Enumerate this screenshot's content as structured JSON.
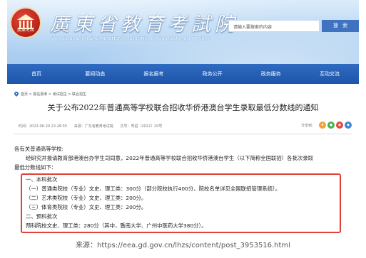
{
  "header": {
    "site_title": "廣東省教育考試院",
    "site_subtitle": "The Education Examinations Authority of Guangdong Province",
    "logo_text": "廣東考試",
    "search_placeholder": "请输入要搜索的内容",
    "search_button": "搜 索"
  },
  "nav": {
    "items": [
      "首页",
      "要闻动态",
      "报名报考",
      "政务公开",
      "政务服务",
      "互动交流"
    ]
  },
  "breadcrumb": {
    "text": "首页 > 报名报考 > 考试招生 > 联合招生"
  },
  "article": {
    "title": "关于公布2022年普通高等学校联合招收华侨港澳台学生录取最低分数线的通知",
    "meta_time": "时间：2022-06-20 22:26:55",
    "meta_source": "来源：广东省教育考试院",
    "meta_doc": "文号：粤招〔2022〕20号",
    "share_label": "分享到：",
    "salutation": "各有关普通高等学校:",
    "para_line1": "经研究并报请教育部港澳台办学生司同意，2022年普通高等学校联合招收华侨港澳台学生（以下简称全国联招）各批次录取",
    "para_line2": "最低分数线如下：",
    "box_lines": [
      "一、本科批次",
      "（一）普通类院校（专业）文史、理工类：300分（部分院校执行400分，院校名单详见全国联招管理系统）。",
      "（二）艺术类院校（专业）文史、理工类：200分。",
      "（三）体育类院校（专业）文史、理工类：200分。",
      "二、预科批次",
      "预科院校文史、理工类：280分（其中，暨南大学、广州中医药大学380分）。"
    ]
  },
  "source_caption": "来源：https://eea.gd.gov.cn/lhzs/content/post_3953516.html",
  "colors": {
    "nav_blue": "#1d56ab",
    "highlight_red": "#e0403a",
    "search_button": "#3f72c1"
  }
}
